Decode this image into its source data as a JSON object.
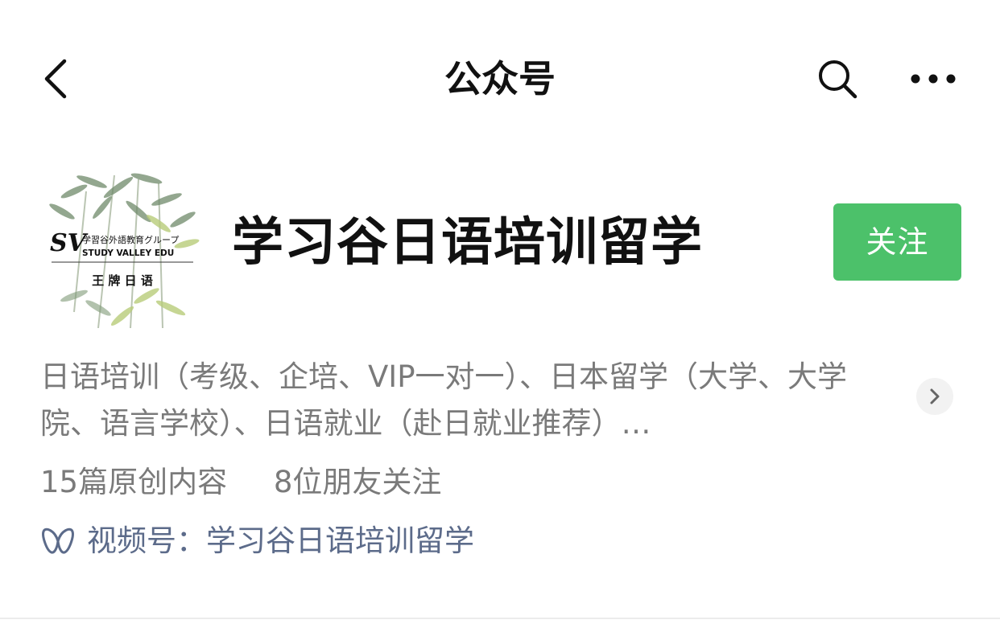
{
  "nav": {
    "title": "公众号",
    "back_icon": "chevron-left-icon",
    "search_icon": "search-icon",
    "more_icon": "more-horizontal-icon"
  },
  "profile": {
    "name": "学习谷日语培训留学",
    "follow_label": "关注",
    "follow_color": "#4cc16a",
    "avatar": {
      "logo_mark": "SV",
      "logo_line1": "学習谷外語教育グループ",
      "logo_line2": "STUDY VALLEY EDU",
      "logo_line3": "王 牌 日 语"
    }
  },
  "description": {
    "text": "日语培训（考级、企培、VIP一对一）、日本留学（大学、大学院、语言学校）、日语就业（赴日就业推荐）…",
    "expand_icon": "chevron-right-icon"
  },
  "stats": {
    "original": "15篇原创内容",
    "friends": "8位朋友关注"
  },
  "channels": {
    "icon": "channels-butterfly-icon",
    "label": "视频号：",
    "value": "学习谷日语培训留学",
    "link_color": "#5c6b8a"
  }
}
